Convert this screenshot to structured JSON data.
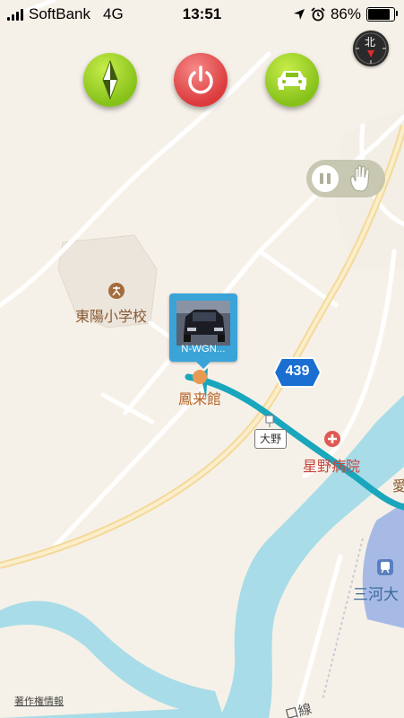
{
  "status_bar": {
    "carrier": "SoftBank",
    "network": "4G",
    "time": "13:51",
    "battery": "86%",
    "battery_level": 0.86
  },
  "toolbar": {
    "compass_button_icon": "compass-needle-icon",
    "power_button_icon": "power-icon",
    "car_button_icon": "car-icon"
  },
  "compass": {
    "north_label": "北"
  },
  "tracking_controls": {
    "pause_icon": "pause-icon",
    "hand_icon": "hand-icon"
  },
  "car_marker": {
    "label": "N-WGN..."
  },
  "map": {
    "labels": {
      "school": "東陽小学校",
      "hall": "鳳来館",
      "hospital": "星野病院",
      "station": "三河大",
      "edge_text": "愛",
      "road_number": "439",
      "place_sign": "大野",
      "bottom_fragment": "口線"
    },
    "credit": "著作権情報"
  },
  "colors": {
    "water": "#a8dce8",
    "route": "#1aa6bd",
    "green_button": "#86c21a",
    "red_button": "#dc3a3c",
    "card": "#3aa3d8",
    "road_shield": "#1a6fd0"
  }
}
